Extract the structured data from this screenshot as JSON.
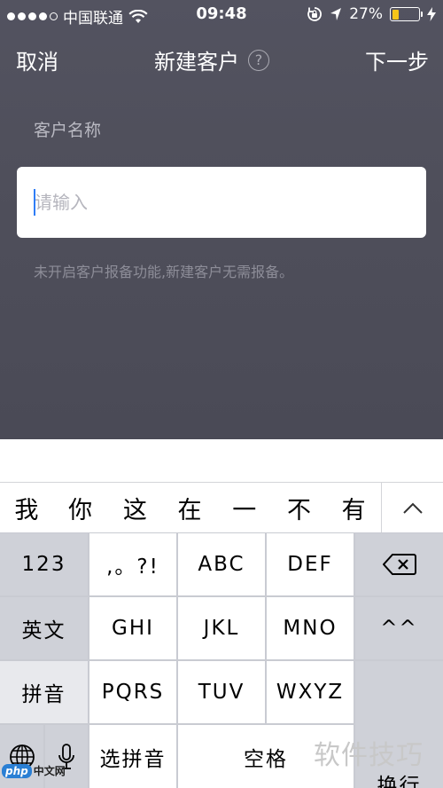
{
  "status_bar": {
    "carrier": "中国联通",
    "time": "09:48",
    "battery": "27%",
    "battery_level": 0.27,
    "signal_bars_filled": 4,
    "colors": {
      "battery_fill": "#f5c518"
    }
  },
  "nav": {
    "cancel": "取消",
    "title": "新建客户",
    "help": "?",
    "next": "下一步"
  },
  "form": {
    "label": "客户名称",
    "input_placeholder": "请输入",
    "input_value": "",
    "hint": "未开启客户报备功能,新建客户无需报备。"
  },
  "keyboard": {
    "candidates": [
      "我",
      "你",
      "这",
      "在",
      "一",
      "不",
      "有"
    ],
    "keys": {
      "num": "123",
      "punct": ",。?!",
      "abc": "ABC",
      "def": "DEF",
      "backspace": "backspace-icon",
      "english": "英文",
      "ghi": "GHI",
      "jkl": "JKL",
      "mno": "MNO",
      "emoji": "^^",
      "pinyin": "拼音",
      "pqrs": "PQRS",
      "tuv": "TUV",
      "wxyz": "WXYZ",
      "return": "换行",
      "globe": "globe-icon",
      "mic": "mic-icon",
      "select_pinyin": "选拼音",
      "space": "空格"
    }
  },
  "watermark": {
    "text": "软件技巧",
    "logo_badge": "php",
    "logo_text": "中文网"
  }
}
